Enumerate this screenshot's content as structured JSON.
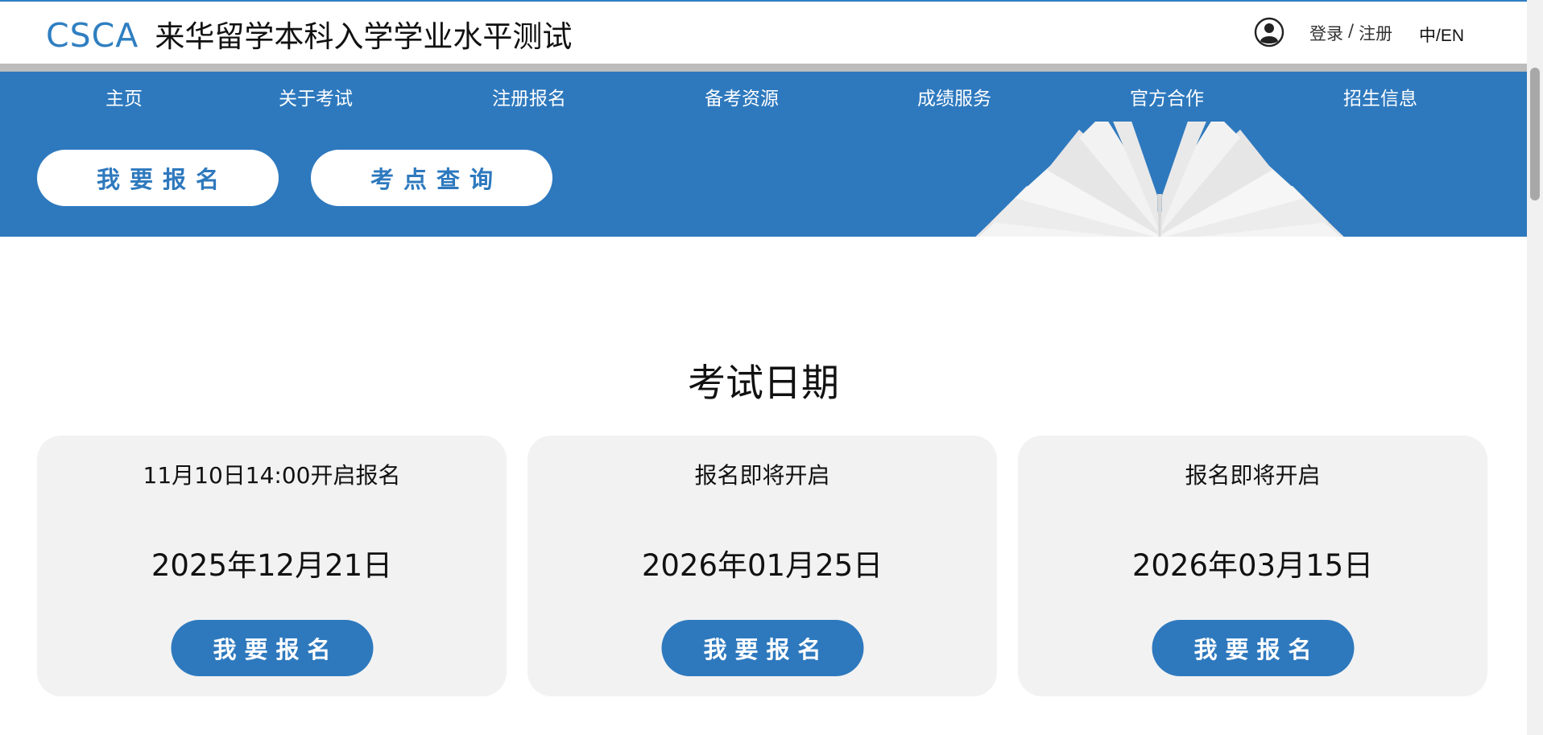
{
  "header": {
    "brand_abbr": "CSCA",
    "brand_name": "来华留学本科入学学业水平测试",
    "user_icon": "user-circle-icon",
    "login_label": "登录",
    "separator": "/",
    "register_label": "注册",
    "language_toggle": "中/EN"
  },
  "nav": {
    "items": [
      "主页",
      "关于考试",
      "注册报名",
      "备考资源",
      "成绩服务",
      "官方合作",
      "招生信息"
    ]
  },
  "banner": {
    "register_button": "我要报名",
    "venue_button": "考点查询",
    "illustration_icon": "open-book-icon"
  },
  "exam_dates": {
    "title": "考试日期",
    "cards": [
      {
        "status": "11月10日14:00开启报名",
        "date": "2025年12月21日",
        "button": "我要报名"
      },
      {
        "status": "报名即将开启",
        "date": "2026年01月25日",
        "button": "我要报名"
      },
      {
        "status": "报名即将开启",
        "date": "2026年03月15日",
        "button": "我要报名"
      }
    ]
  },
  "colors": {
    "accent_blue": "#2e79be",
    "brand_blue": "#2f7fc1",
    "card_background": "#f2f2f2",
    "book_cover": "#f0a020"
  }
}
